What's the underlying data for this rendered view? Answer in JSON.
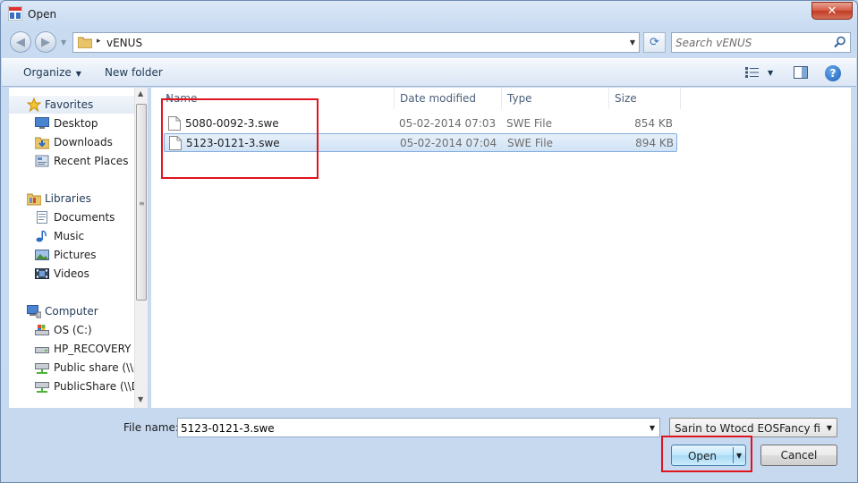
{
  "window": {
    "title": "Open",
    "close_glyph": "✕"
  },
  "address_bar": {
    "path": [
      "vENUS"
    ],
    "separator_glyph": "▸",
    "search_placeholder": "Search vENUS"
  },
  "toolbar": {
    "organize_label": "Organize",
    "new_folder_label": "New folder"
  },
  "sidebar": {
    "groups": [
      {
        "label": "Favorites",
        "icon": "star-icon",
        "items": [
          {
            "label": "Desktop",
            "icon": "desktop-icon"
          },
          {
            "label": "Downloads",
            "icon": "downloads-icon"
          },
          {
            "label": "Recent Places",
            "icon": "recent-places-icon"
          }
        ]
      },
      {
        "label": "Libraries",
        "icon": "libraries-icon",
        "items": [
          {
            "label": "Documents",
            "icon": "documents-icon"
          },
          {
            "label": "Music",
            "icon": "music-icon"
          },
          {
            "label": "Pictures",
            "icon": "pictures-icon"
          },
          {
            "label": "Videos",
            "icon": "videos-icon"
          }
        ]
      },
      {
        "label": "Computer",
        "icon": "computer-icon",
        "items": [
          {
            "label": "OS (C:)",
            "icon": "drive-icon"
          },
          {
            "label": "HP_RECOVERY (D",
            "icon": "drive-icon"
          },
          {
            "label": "Public share (\\\\d",
            "icon": "network-drive-icon"
          },
          {
            "label": "PublicShare (\\\\DI",
            "icon": "network-drive-icon"
          }
        ]
      }
    ]
  },
  "file_list": {
    "columns": [
      "Name",
      "Date modified",
      "Type",
      "Size"
    ],
    "rows": [
      {
        "name": "5080-0092-3.swe",
        "date": "05-02-2014 07:03",
        "type": "SWE File",
        "size": "854 KB",
        "selected": false
      },
      {
        "name": "5123-0121-3.swe",
        "date": "05-02-2014 07:04",
        "type": "SWE File",
        "size": "894 KB",
        "selected": true
      }
    ]
  },
  "bottom": {
    "file_name_label": "File name:",
    "file_name_value": "5123-0121-3.swe",
    "file_type_filter": "Sarin to Wtocd EOSFancy files (",
    "open_label": "Open",
    "cancel_label": "Cancel"
  },
  "colors": {
    "annotation_red": "#e0141e",
    "selection_border": "#84acdd",
    "window_chrome": "#c6d9ef"
  }
}
